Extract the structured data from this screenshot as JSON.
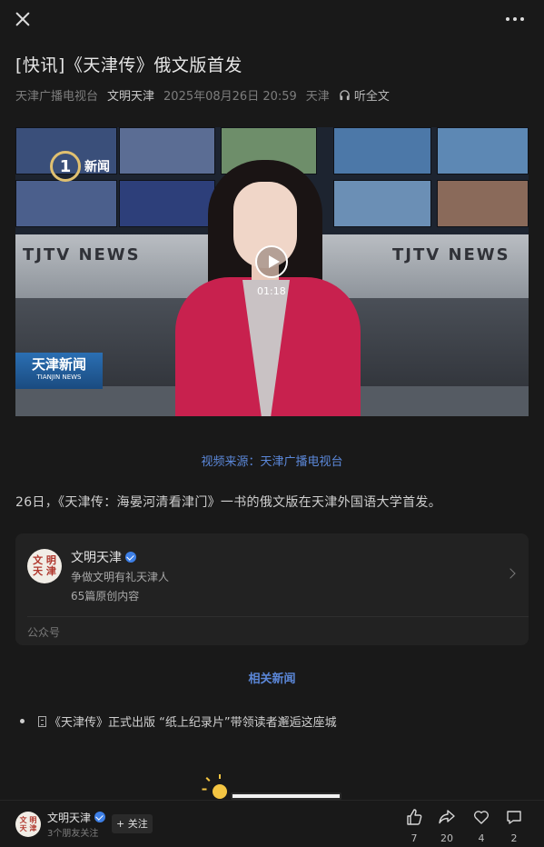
{
  "article": {
    "title": "[快讯]《天津传》俄文版首发",
    "source_org": "天津广播电视台",
    "account": "文明天津",
    "datetime": "2025年08月26日 20:59",
    "location": "天津",
    "listen_label": "听全文"
  },
  "video": {
    "channel_logo_text": "新闻",
    "banner_text": "TJTV NEWS",
    "badge_text": "天津新闻",
    "badge_sub": "TIANJIN NEWS",
    "duration": "01:18"
  },
  "video_source": "视频来源：天津广播电视台",
  "body": "26日，《天津传：海晏河清看津门》一书的俄文版在天津外国语大学首发。",
  "account_card": {
    "avatar_text": "文明天津",
    "name": "文明天津",
    "slogan": "争做文明有礼天津人",
    "original_count": "65篇原创内容",
    "type": "公众号"
  },
  "related": {
    "title": "相关新闻",
    "items": [
      "《天津传》正式出版 “纸上纪录片”带领读者邂逅这座城"
    ]
  },
  "bottom_bar": {
    "account_name": "文明天津",
    "friends_follow": "3个朋友关注",
    "follow_label": "+ 关注",
    "likes": "7",
    "shares": "20",
    "favorites": "4",
    "comments": "2"
  },
  "colors": {
    "background": "#191919",
    "link_blue": "#5b87d8",
    "verified_blue": "#3d7fe6"
  }
}
